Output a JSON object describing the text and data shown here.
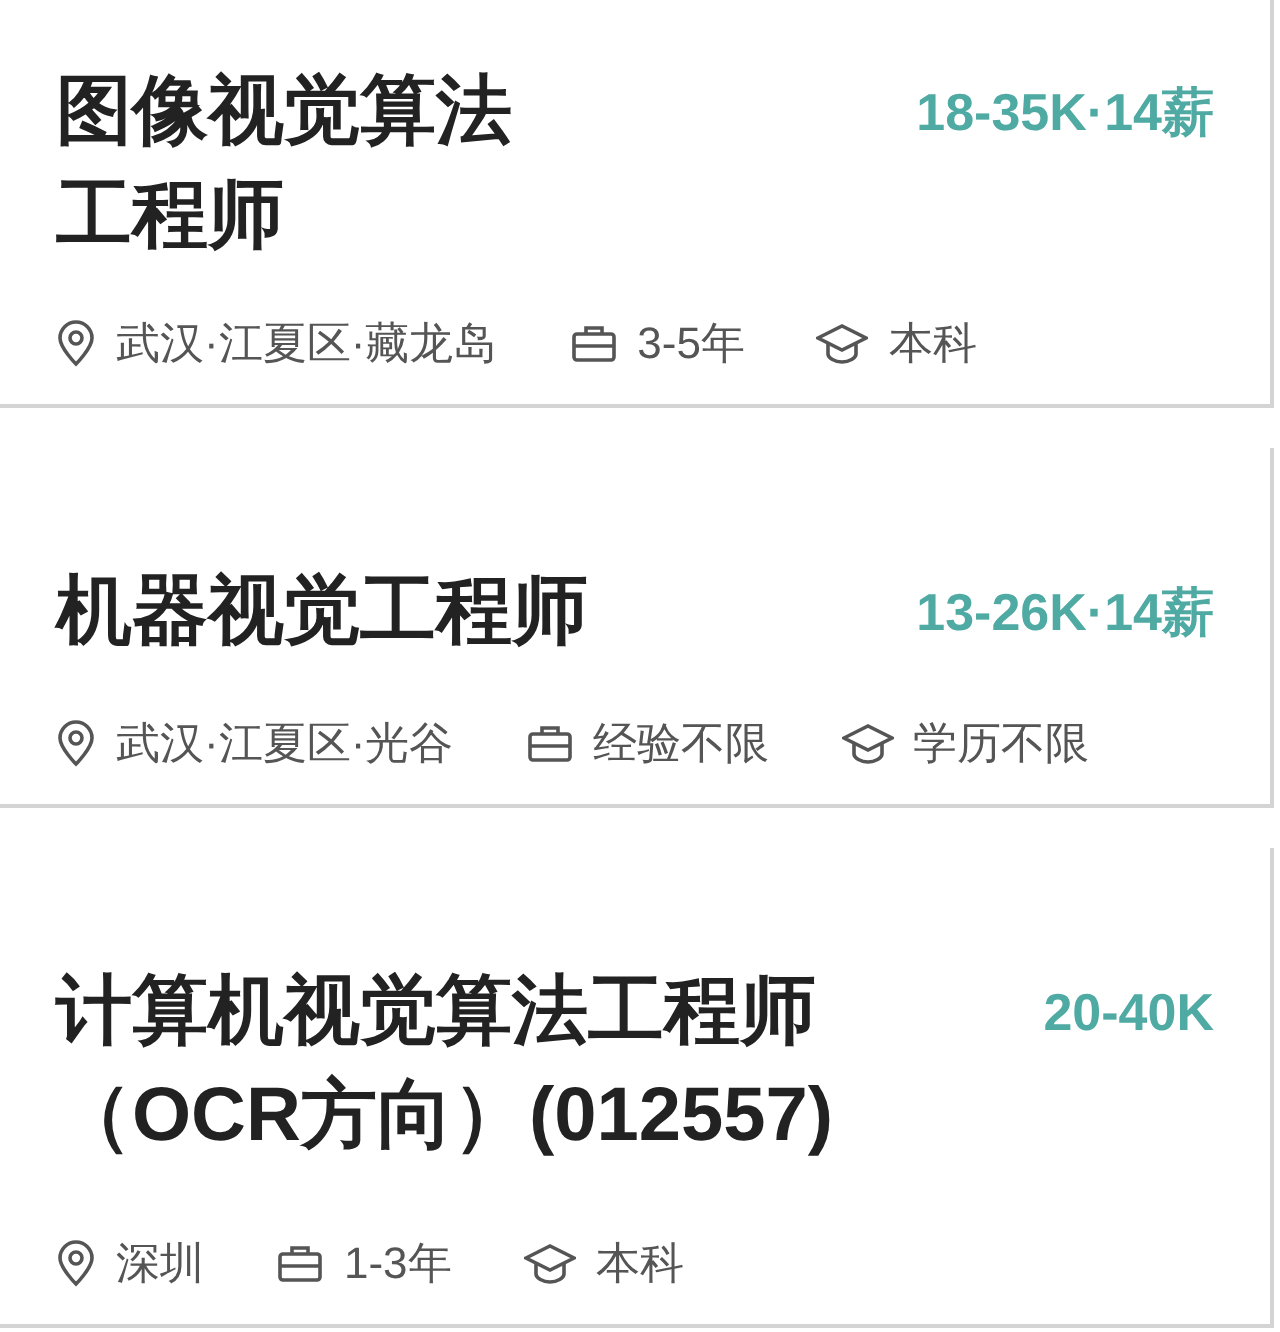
{
  "jobs": [
    {
      "title": "图像视觉算法工程师",
      "salary": "18-35K·14薪",
      "location": "武汉·江夏区·藏龙岛",
      "experience": "3-5年",
      "education": "本科"
    },
    {
      "title": "机器视觉工程师",
      "salary": "13-26K·14薪",
      "location": "武汉·江夏区·光谷",
      "experience": "经验不限",
      "education": "学历不限"
    },
    {
      "title": "计算机视觉算法工程师（OCR方向）(012557)",
      "salary": "20-40K",
      "location": "深圳",
      "experience": "1-3年",
      "education": "本科"
    }
  ]
}
